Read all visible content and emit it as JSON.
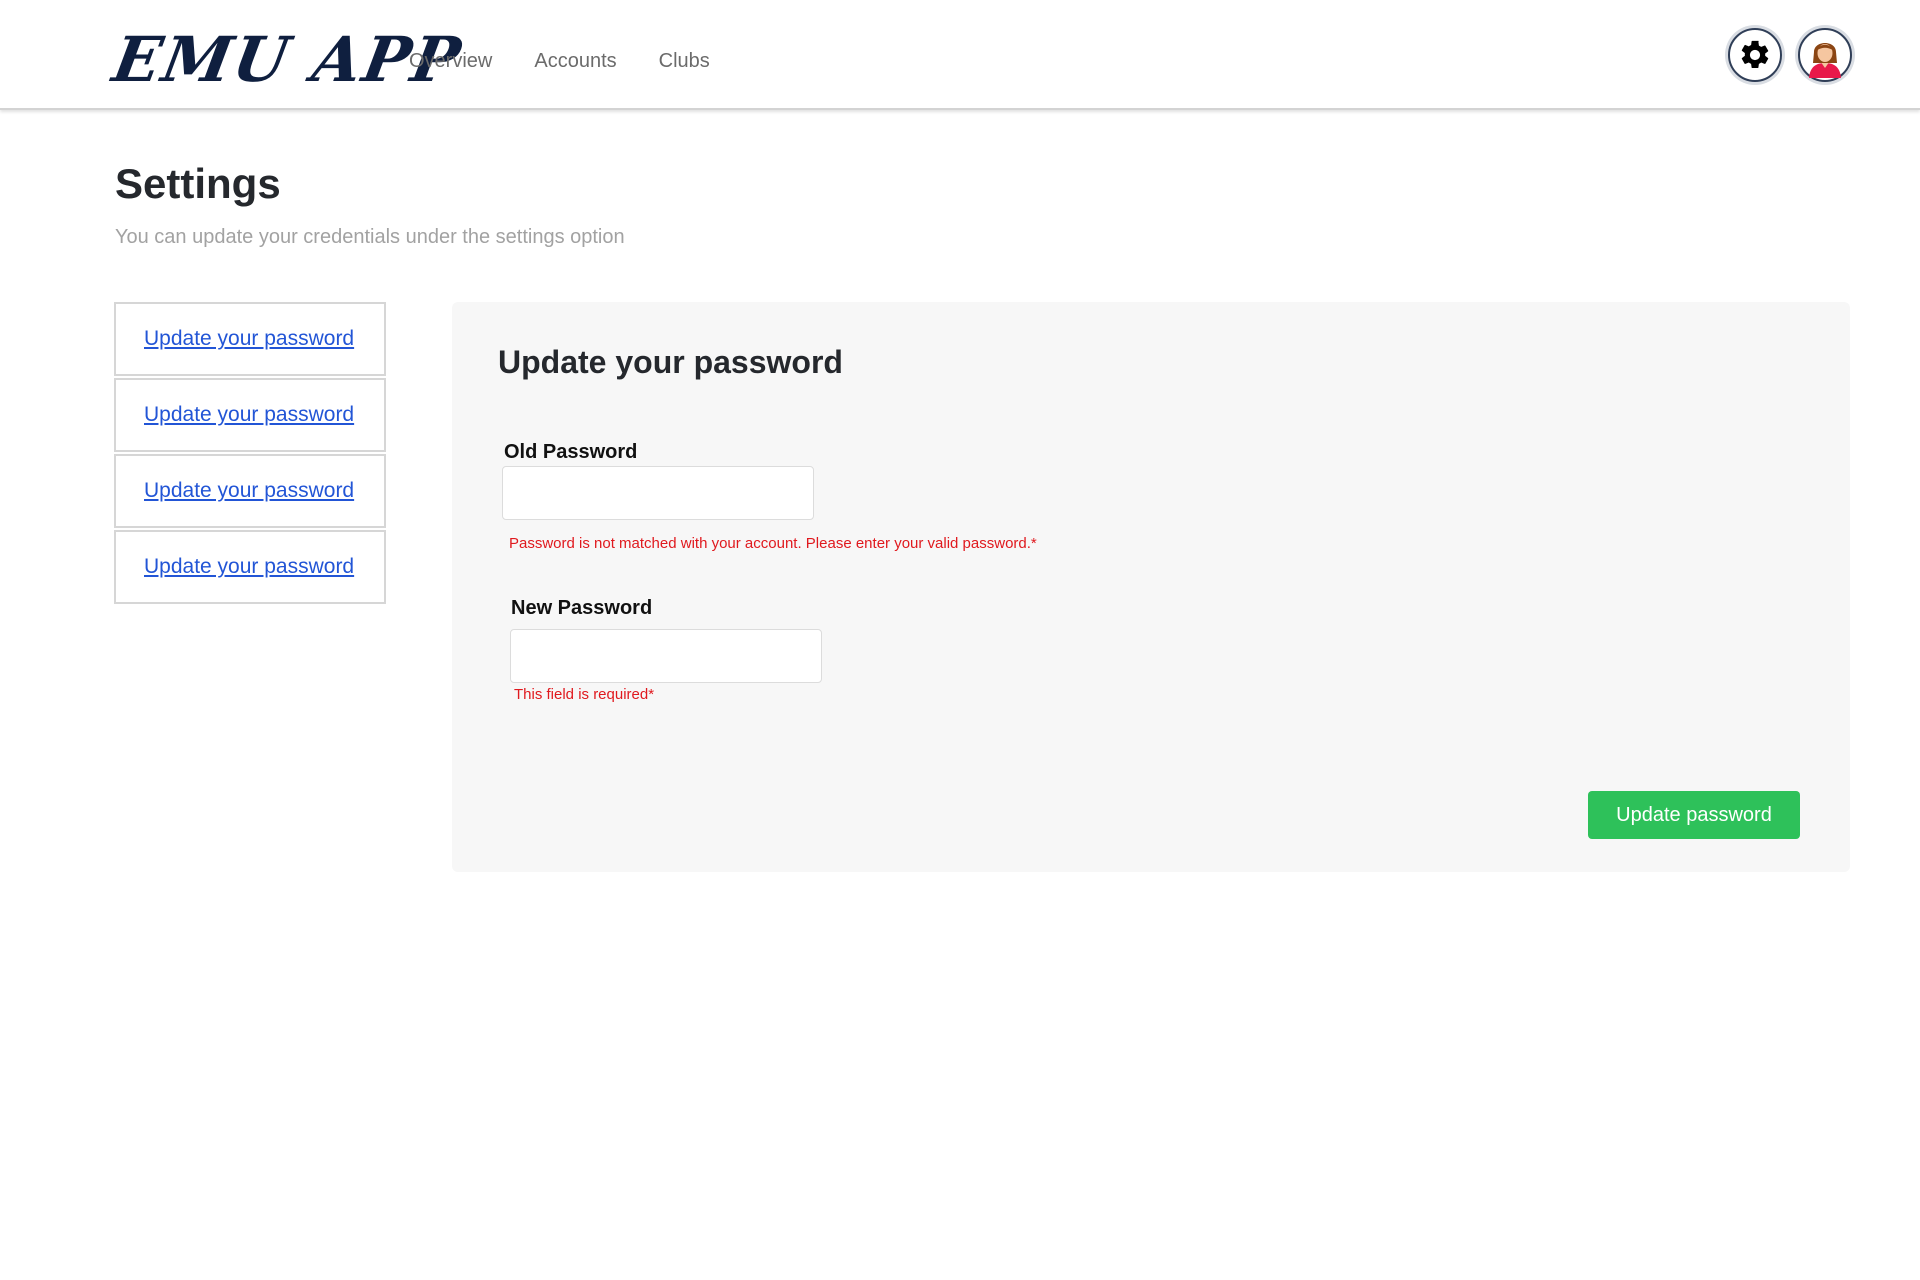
{
  "header": {
    "logo_text": "EMU APP",
    "nav": [
      {
        "label": "Overview"
      },
      {
        "label": "Accounts"
      },
      {
        "label": "Clubs"
      }
    ],
    "icons": {
      "settings": "gear-icon",
      "profile": "user-avatar-icon"
    }
  },
  "page": {
    "title": "Settings",
    "subtitle": "You can update your credentials under the settings option"
  },
  "sidebar": {
    "items": [
      {
        "label": "Update your password"
      },
      {
        "label": "Update your password"
      },
      {
        "label": "Update your password"
      },
      {
        "label": "Update your password"
      }
    ]
  },
  "form": {
    "title": "Update your password",
    "old_password": {
      "label": "Old Password",
      "value": "",
      "placeholder": "",
      "error": "Password is not matched with your account. Please enter your valid password.*"
    },
    "new_password": {
      "label": "New Password",
      "value": "",
      "placeholder": "",
      "error": "This field is required*"
    },
    "submit_label": "Update password"
  },
  "colors": {
    "accent_green": "#2ec15a",
    "error_red": "#e0191e",
    "link_blue": "#2255d6",
    "logo_navy": "#0f1f3f"
  }
}
